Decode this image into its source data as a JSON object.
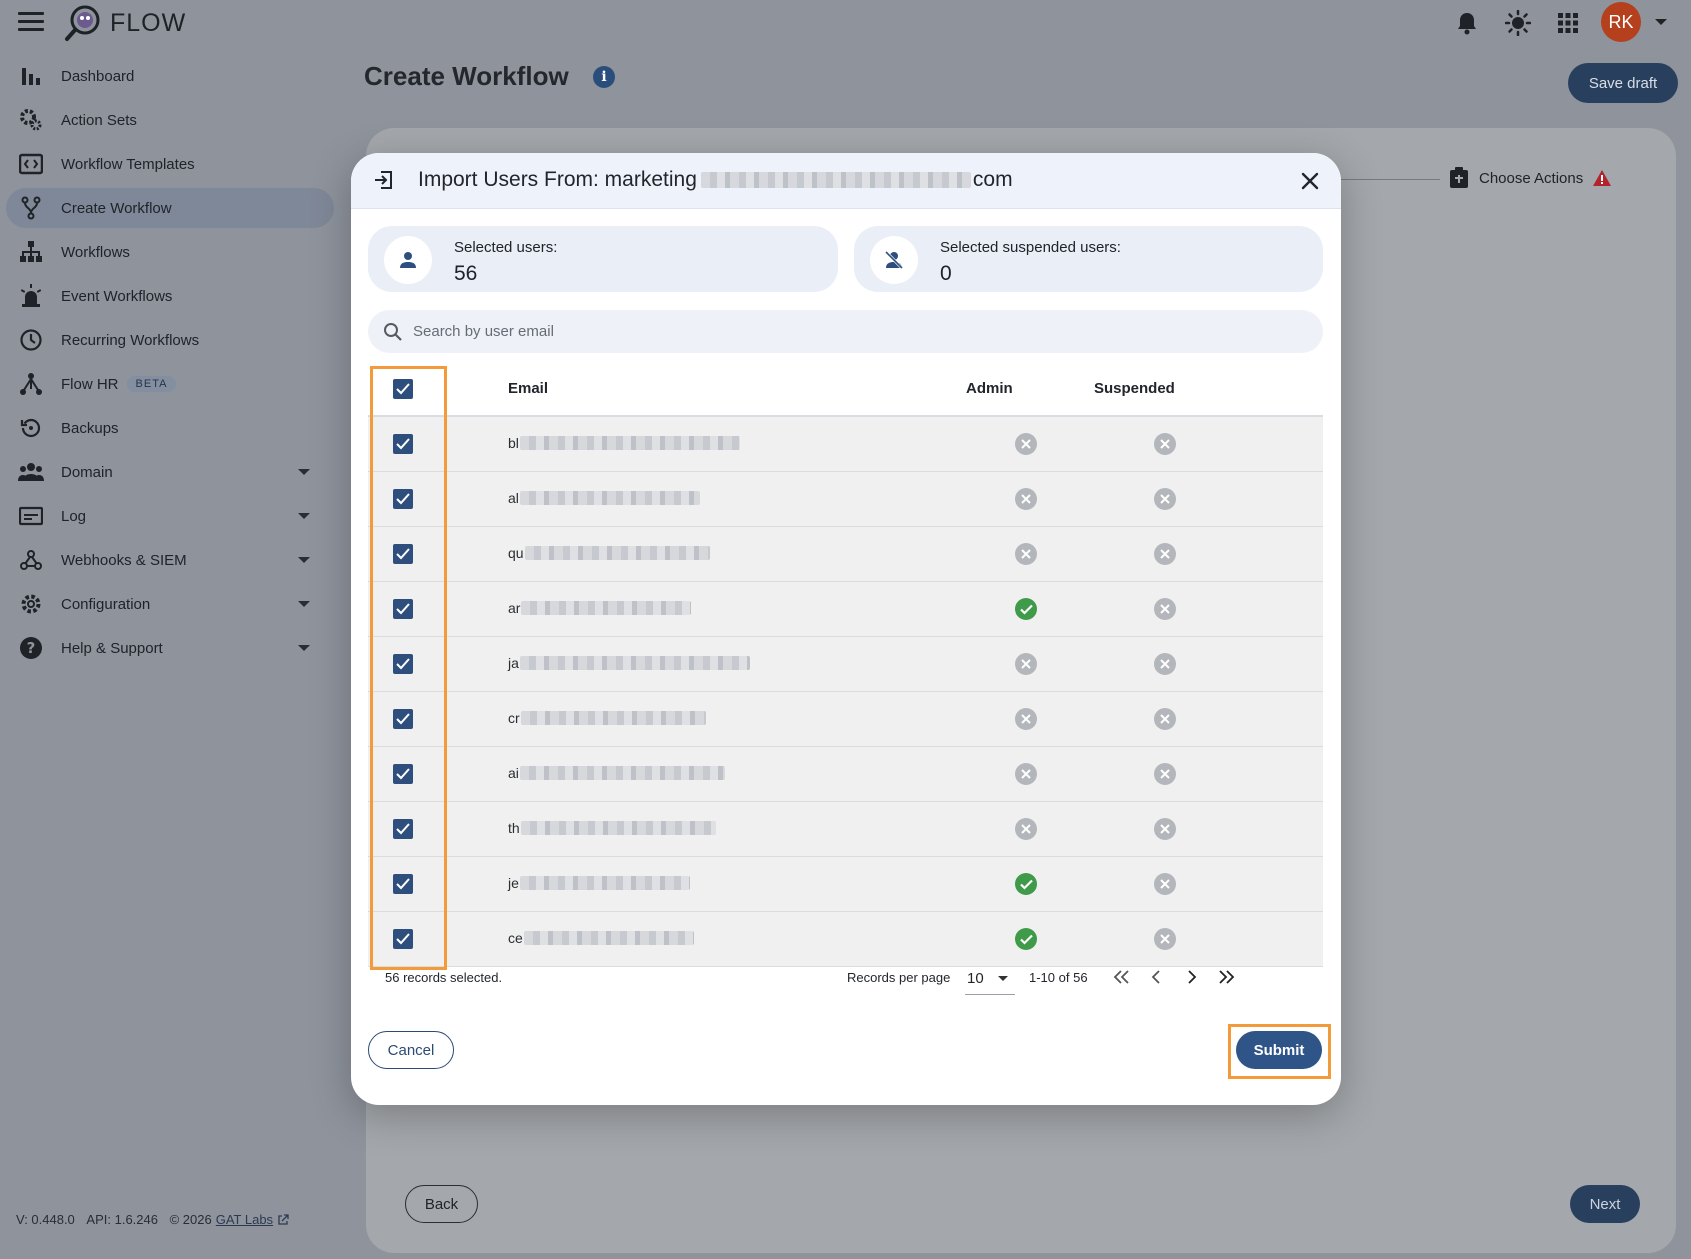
{
  "app": {
    "name": "FLOW",
    "user_initials": "RK"
  },
  "sidebar": {
    "items": [
      {
        "label": "Dashboard"
      },
      {
        "label": "Action Sets"
      },
      {
        "label": "Workflow Templates"
      },
      {
        "label": "Create Workflow",
        "active": true
      },
      {
        "label": "Workflows"
      },
      {
        "label": "Event Workflows"
      },
      {
        "label": "Recurring Workflows"
      },
      {
        "label": "Flow HR",
        "badge": "BETA"
      },
      {
        "label": "Backups"
      },
      {
        "label": "Domain"
      },
      {
        "label": "Log"
      },
      {
        "label": "Webhooks & SIEM"
      },
      {
        "label": "Configuration"
      },
      {
        "label": "Help & Support"
      }
    ],
    "footer": {
      "version": "V: 0.448.0",
      "api": "API: 1.6.246",
      "copyright": "© 2026",
      "link": "GAT Labs"
    }
  },
  "page": {
    "title": "Create Workflow",
    "save_draft": "Save draft",
    "step_label": "Choose Actions",
    "back": "Back",
    "next": "Next"
  },
  "modal": {
    "title_prefix": "Import Users From: marketing",
    "title_suffix": "com",
    "selected_users_label": "Selected users:",
    "selected_users_value": "56",
    "selected_suspended_label": "Selected suspended users:",
    "selected_suspended_value": "0",
    "search_placeholder": "Search by user email",
    "columns": {
      "email": "Email",
      "admin": "Admin",
      "suspended": "Suspended"
    },
    "rows": [
      {
        "email": "bl",
        "admin": false,
        "suspended": false
      },
      {
        "email": "al",
        "admin": false,
        "suspended": false
      },
      {
        "email": "qu",
        "admin": false,
        "suspended": false
      },
      {
        "email": "ar",
        "admin": true,
        "suspended": false
      },
      {
        "email": "ja",
        "admin": false,
        "suspended": false
      },
      {
        "email": "cr",
        "admin": false,
        "suspended": false
      },
      {
        "email": "ai",
        "admin": false,
        "suspended": false
      },
      {
        "email": "th",
        "admin": false,
        "suspended": false
      },
      {
        "email": "je",
        "admin": true,
        "suspended": false
      },
      {
        "email": "ce",
        "admin": true,
        "suspended": false
      }
    ],
    "records_selected": "56 records selected.",
    "records_per_page_label": "Records per page",
    "records_per_page": "10",
    "range": "1-10 of 56",
    "cancel": "Cancel",
    "submit": "Submit"
  },
  "colors": {
    "primary": "#2e5488",
    "highlight": "#f39a3b",
    "admin_yes": "#3f9a4a",
    "no": "#b3b6ba",
    "avatar": "#b5401d"
  }
}
